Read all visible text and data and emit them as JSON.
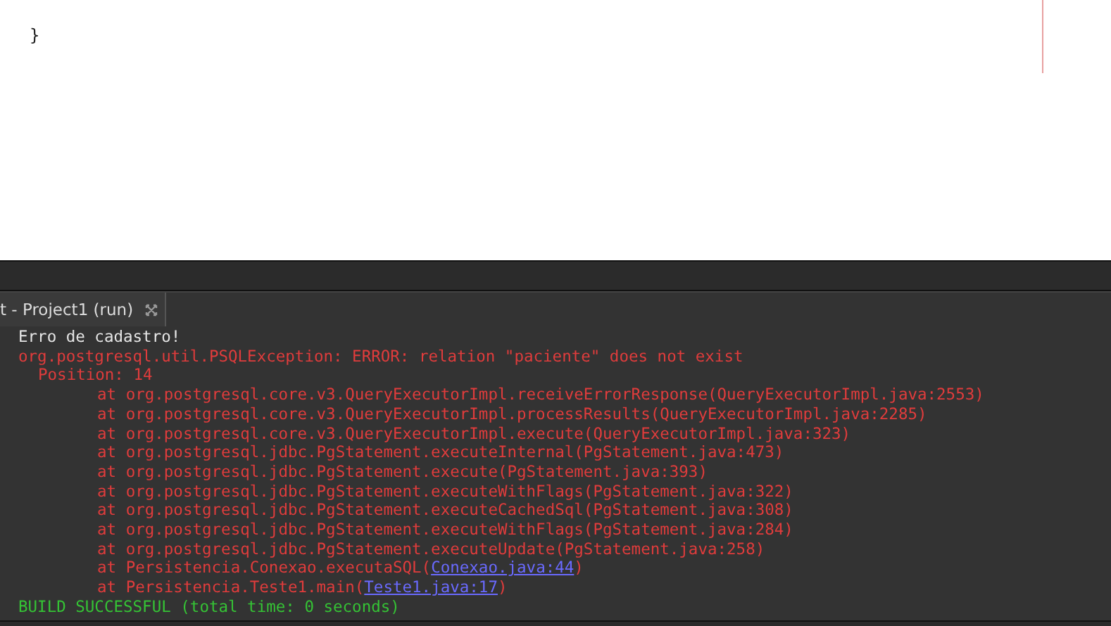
{
  "editor": {
    "lines": [
      "}"
    ]
  },
  "output": {
    "tab": {
      "label": "t - Project1 (run)",
      "selected": true
    },
    "lines": [
      {
        "kind": "plain",
        "text": "Erro de cadastro!"
      },
      {
        "kind": "error",
        "text": "org.postgresql.util.PSQLException: ERROR: relation \"paciente\" does not exist"
      },
      {
        "kind": "detail",
        "text": "Position: 14"
      },
      {
        "kind": "frame",
        "text": "at org.postgresql.core.v3.QueryExecutorImpl.receiveErrorResponse(QueryExecutorImpl.java:2553)"
      },
      {
        "kind": "frame",
        "text": "at org.postgresql.core.v3.QueryExecutorImpl.processResults(QueryExecutorImpl.java:2285)"
      },
      {
        "kind": "frame",
        "text": "at org.postgresql.core.v3.QueryExecutorImpl.execute(QueryExecutorImpl.java:323)"
      },
      {
        "kind": "frame",
        "text": "at org.postgresql.jdbc.PgStatement.executeInternal(PgStatement.java:473)"
      },
      {
        "kind": "frame",
        "text": "at org.postgresql.jdbc.PgStatement.execute(PgStatement.java:393)"
      },
      {
        "kind": "frame",
        "text": "at org.postgresql.jdbc.PgStatement.executeWithFlags(PgStatement.java:322)"
      },
      {
        "kind": "frame",
        "text": "at org.postgresql.jdbc.PgStatement.executeCachedSql(PgStatement.java:308)"
      },
      {
        "kind": "frame",
        "text": "at org.postgresql.jdbc.PgStatement.executeWithFlags(PgStatement.java:284)"
      },
      {
        "kind": "frame",
        "text": "at org.postgresql.jdbc.PgStatement.executeUpdate(PgStatement.java:258)"
      },
      {
        "kind": "frame",
        "text": "at Persistencia.Conexao.executaSQL(",
        "link": "Conexao.java:44",
        "after": ")"
      },
      {
        "kind": "frame",
        "text": "at Persistencia.Teste1.main(",
        "link": "Teste1.java:17",
        "after": ")"
      },
      {
        "kind": "success",
        "text": "BUILD SUCCESSFUL (total time: 0 seconds)"
      }
    ]
  }
}
